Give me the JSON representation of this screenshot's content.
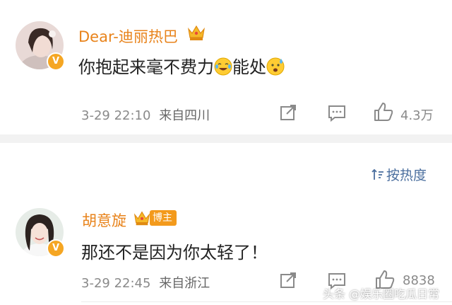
{
  "comments": [
    {
      "username": "Dear-迪丽热巴",
      "text_part1": "你抱起来毫不费力",
      "text_part2": "能处",
      "emoji1": "laughing-crying-emoji",
      "emoji2": "sweating-emoji",
      "time": "3-29 22:10",
      "location": "来自四川",
      "likes": "4.3万",
      "verified_mark": "V"
    },
    {
      "username": "胡意旋",
      "role_badge": "博主",
      "text": "那还不是因为你太轻了！",
      "time": "3-29 22:45",
      "location": "来自浙江",
      "likes": "8838",
      "verified_mark": "V"
    }
  ],
  "sort": {
    "label": "按热度",
    "icon": "sort-icon"
  },
  "watermark": "头条 @娱乐圈吃瓜日常",
  "colors": {
    "username": "#e8831b",
    "meta": "#8a8a8a",
    "sort": "#4a6e9e",
    "separator": "#f2f2f2",
    "badge": "#f5a623"
  }
}
